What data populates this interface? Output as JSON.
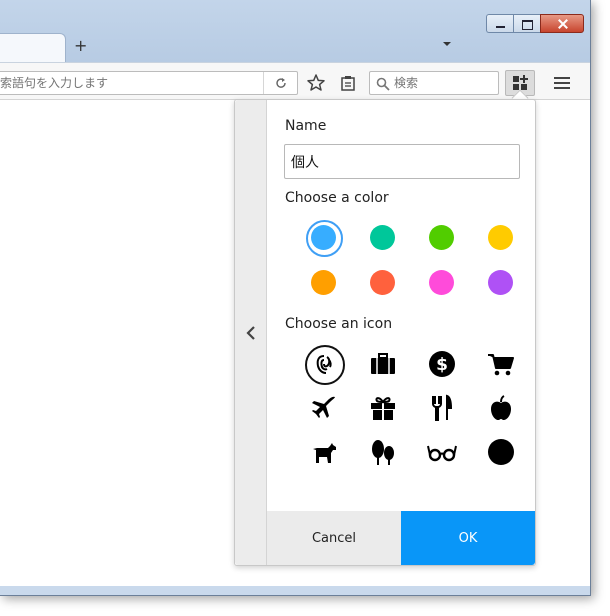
{
  "browser": {
    "new_tab_label": "+",
    "url_placeholder": "検索語句を入力します",
    "search_placeholder": "検索"
  },
  "panel": {
    "name_label": "Name",
    "name_value": "個人",
    "color_label": "Choose a color",
    "colors": [
      {
        "name": "blue",
        "hex": "#37adff",
        "selected": true
      },
      {
        "name": "turquoise",
        "hex": "#00c79a",
        "selected": false
      },
      {
        "name": "green",
        "hex": "#51cd00",
        "selected": false
      },
      {
        "name": "yellow",
        "hex": "#ffcb00",
        "selected": false
      },
      {
        "name": "orange",
        "hex": "#ff9f00",
        "selected": false
      },
      {
        "name": "red",
        "hex": "#ff613d",
        "selected": false
      },
      {
        "name": "pink",
        "hex": "#ff4bda",
        "selected": false
      },
      {
        "name": "purple",
        "hex": "#af51f5",
        "selected": false
      }
    ],
    "icon_label": "Choose an icon",
    "icons": [
      "fingerprint-icon",
      "briefcase-icon",
      "dollar-icon",
      "cart-icon",
      "plane-icon",
      "gift-icon",
      "food-icon",
      "fruit-icon",
      "dog-icon",
      "tree-icon",
      "glasses-icon",
      "circle-icon"
    ],
    "cancel_label": "Cancel",
    "ok_label": "OK"
  },
  "colors": {
    "accent": "#0996f8",
    "frame": "#c9d9ec"
  }
}
